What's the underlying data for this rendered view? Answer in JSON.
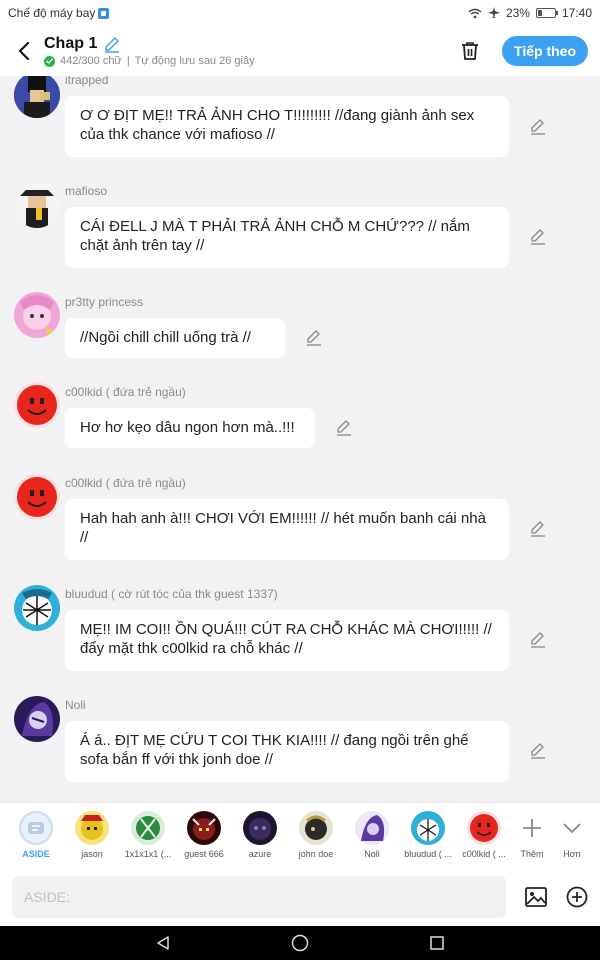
{
  "status_bar": {
    "mode_label": "Chế độ máy bay",
    "battery": "23%",
    "time": "17:40"
  },
  "header": {
    "title": "Chap 1",
    "word_count": "442/300 chữ",
    "autosave": "Tự động lưu sau 26 giây",
    "next_label": "Tiếp theo"
  },
  "messages": [
    {
      "name": "itrapped",
      "text": "Ơ Ơ ĐỊT MẸ!! TRẢ ẢNH CHO T!!!!!!!!! //đang giành ảnh sex của thk chance với mafioso //"
    },
    {
      "name": "mafioso",
      "text": "CÁI ĐELL J MÀ T PHẢI TRẢ ẢNH CHỖ M CHỨ??? // nắm chặt ảnh trên tay //"
    },
    {
      "name": "pr3tty princess",
      "text": "//Ngồi chill chill uống trà //"
    },
    {
      "name": "c00lkid ( đứa trẻ ngầu)",
      "text": "Hơ hơ kẹo dâu ngon hơn mà..!!!"
    },
    {
      "name": "c00lkid ( đứa trẻ ngầu)",
      "text": "Hah hah anh à!!! CHƠI VỚI EM!!!!!! // hét muốn banh cái nhà //"
    },
    {
      "name": "bluudud ( cờ rút tóc của thk guest 1337)",
      "text": "MẸ!! IM COI!! ỒN QUÁ!!! CÚT RA CHỖ KHÁC MÀ CHƠI!!!!! // đẩy mặt thk c00lkid ra chỗ khác //"
    },
    {
      "name": "Noli",
      "text": "Á á.. ĐỊT MẸ CỨU T COI THK KIA!!!! // đang ngồi trên ghế sofa bắn ff với thk jonh doe //"
    }
  ],
  "characters": [
    {
      "name": "ASIDE",
      "icon": "aside-icon"
    },
    {
      "name": "jason",
      "color": "#e8c21a"
    },
    {
      "name": "1x1x1x1 (...",
      "color": "#2c8a3e"
    },
    {
      "name": "guest 666",
      "color": "#8b1a1a"
    },
    {
      "name": "azure",
      "color": "#3a2b5c"
    },
    {
      "name": "john doe",
      "color": "#2a2a2a"
    },
    {
      "name": "Noli",
      "color": "#5a3aa0"
    },
    {
      "name": "bluudud ( ...",
      "color": "#2eb0d8"
    },
    {
      "name": "c00lkid ( ...",
      "color": "#e8261e"
    }
  ],
  "more": {
    "add_label": "Thêm",
    "more_label": "Hơn"
  },
  "input": {
    "placeholder": "ASIDE:"
  }
}
